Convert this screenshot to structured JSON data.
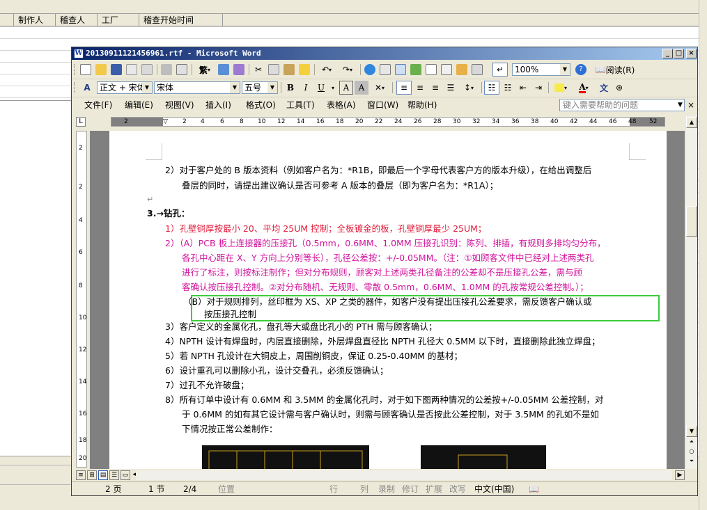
{
  "background_app": {
    "columns": [
      "制作人",
      "稽查人",
      "工厂",
      "稽查开始时间"
    ]
  },
  "window": {
    "title": "20130911121456961.rtf - Microsoft Word",
    "icon_letter": "W",
    "minimize": "_",
    "restore": "□",
    "close": "×"
  },
  "toolbar_standard": {
    "zoom": "100%",
    "read_label": "阅读(R)"
  },
  "toolbar_format": {
    "style": "正文 + 宋体",
    "font": "宋体",
    "size": "五号",
    "bold": "B",
    "italic": "I",
    "underline": "U",
    "char_border": "A",
    "char_shade": "A",
    "font_color": "A",
    "pinyin": "文"
  },
  "menu": {
    "items": [
      "文件(F)",
      "编辑(E)",
      "视图(V)",
      "插入(I)",
      "格式(O)",
      "工具(T)",
      "表格(A)",
      "窗口(W)",
      "帮助(H)"
    ],
    "help_placeholder": "键入需要帮助的问题",
    "close": "×"
  },
  "ruler": {
    "corner": "L",
    "ticks": [
      "2",
      "2",
      "4",
      "6",
      "8",
      "10",
      "12",
      "14",
      "16",
      "18",
      "20",
      "22",
      "24",
      "26",
      "28",
      "30",
      "32",
      "34",
      "36",
      "38",
      "40",
      "42",
      "44",
      "46",
      "48",
      "52"
    ],
    "vticks": [
      "2",
      "2",
      "4",
      "6",
      "8",
      "10",
      "12",
      "14",
      "16",
      "18",
      "20"
    ]
  },
  "document": {
    "lines": [
      {
        "text": "2）对于客户处的 B 版本资料（例如客户名为：*R1B，即最后一个字母代表客户方的版本升级），在给出调整后",
        "color": "black"
      },
      {
        "text": "叠层的同时，请提出建议确认是否可参考 A 版本的叠层（即为客户名为：*R1A）；",
        "color": "black"
      },
      {
        "text": "↵",
        "color": "gray"
      },
      {
        "text": "3.→钻孔：",
        "color": "black"
      },
      {
        "text": "1）孔壁铜厚按最小 20、平均 25UM 控制；全板镀金的板，孔壁铜厚最少 25UM；",
        "color": "red"
      },
      {
        "text": "2）（A）PCB 板上连接器的压接孔（0.5mm，0.6MM、1.0MM 压接孔识别：陈列、排插，有规则多排均匀分布，",
        "color": "magenta"
      },
      {
        "text": "各孔中心距在 X、Y 方向上分别等长），孔径公差按：+/-0.05MM。（注：①如顾客文件中已经对上述两类孔",
        "color": "magenta"
      },
      {
        "text": "进行了标注，则按标注制作；但对分布规则，顾客对上述两类孔径备注的公差却不是压接孔公差，需与顾",
        "color": "magenta"
      },
      {
        "text": "客确认按压接孔控制。②对分布随机、无规则、零散 0.5mm，0.6MM、1.0MM 的孔按常规公差控制。）；",
        "color": "magenta"
      },
      {
        "text": "（B）对于规则排列，丝印框为 XS、XP 之类的器件，如客户没有提出压接孔公差要求，需反馈客户确认或",
        "color": "black"
      },
      {
        "text": "按压接孔控制",
        "color": "black"
      },
      {
        "text": "3）客户定义的金属化孔，盘孔等大或盘比孔小的 PTH 需与顾客确认；",
        "color": "black"
      },
      {
        "text": "4）NPTH 设计有焊盘时，内层直接删除，外层焊盘直径比 NPTH 孔径大 0.5MM 以下时，直接删除此独立焊盘；",
        "color": "black"
      },
      {
        "text": "5）若 NPTH 孔设计在大铜皮上，周围削铜皮，保证 0.25-0.40MM 的基材；",
        "color": "black"
      },
      {
        "text": "6）设计重孔可以删除小孔，设计交叠孔，必须反馈确认；",
        "color": "black"
      },
      {
        "text": "7）过孔不允许破盘；",
        "color": "black"
      },
      {
        "text": "8）所有订单中设计有 0.6MM 和 3.5MM 的金属化孔时，对于如下图两种情况的公差按+/-0.05MM 公差控制，对",
        "color": "black"
      },
      {
        "text": "于 0.6MM 的如有其它设计需与客户确认时，则需与顾客确认是否按此公差控制，对于 3.5MM 的孔如不是如",
        "color": "black"
      },
      {
        "text": "下情况按正常公差制作：",
        "color": "black"
      }
    ]
  },
  "statusbar": {
    "page": "2 页",
    "section": "1 节",
    "pages": "2/4",
    "position": "位置",
    "line": "行",
    "column": "列",
    "record": "录制",
    "track": "修订",
    "extend": "扩展",
    "overtype": "改写",
    "language": "中文(中国)"
  },
  "colors": {
    "red_text": "#e31d3d",
    "magenta_text": "#d2149c",
    "highlight_box": "#3ccc3c",
    "title_gradient_start": "#0a246a"
  }
}
